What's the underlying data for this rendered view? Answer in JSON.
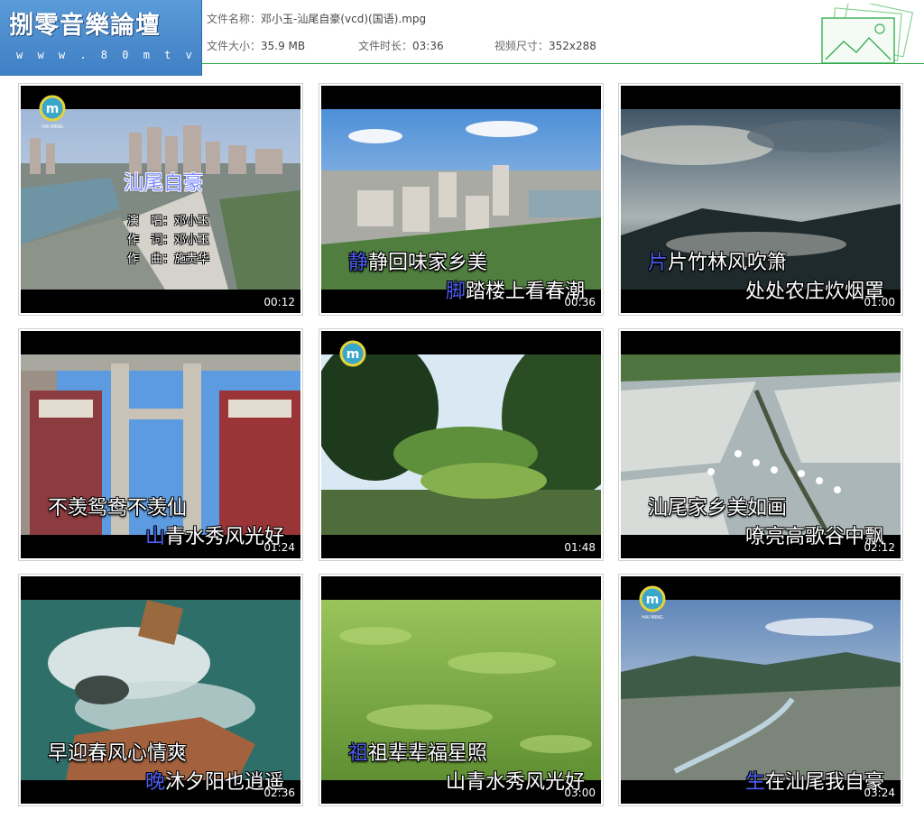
{
  "site": {
    "name": "捌零音樂論壇",
    "url": "w w w . 8 0 m t v . c o m"
  },
  "file": {
    "name_label": "文件名称：",
    "name_value": "邓小玉-汕尾自豪(vcd)(国语).mpg",
    "size_label": "文件大小：",
    "size_value": "35.9 MB",
    "duration_label": "文件时长：",
    "duration_value": "03:36",
    "dimensions_label": "视频尺寸：",
    "dimensions_value": "352x288"
  },
  "colors": {
    "logo_bg": "#4a8ccf",
    "header_rule": "#2ea84a",
    "lyric_highlight": "#4b5cf0"
  },
  "thumbnails": [
    {
      "time": "00:12",
      "title": "汕尾自豪",
      "credits": [
        "演　唱：邓小玉",
        "作　词：邓小玉",
        "作　曲：施贵华"
      ],
      "logo_text": "HAI MING"
    },
    {
      "time": "00:36",
      "line1_hl": "静",
      "line1": "静回味家乡美",
      "line2_hl": "脚",
      "line2": "踏楼上看春潮"
    },
    {
      "time": "01:00",
      "line1_hl": "片",
      "line1": "片竹林风吹箫",
      "line2_hl": "",
      "line2": "处处农庄炊烟罩"
    },
    {
      "time": "01:24",
      "line1_hl": "",
      "line1": "不羡鸳鸯不羡仙",
      "line2_hl": "山",
      "line2": "青水秀风光好"
    },
    {
      "time": "01:48",
      "logo_text": ""
    },
    {
      "time": "02:12",
      "line1_hl": "",
      "line1": "汕尾家乡美如画",
      "line2_hl": "",
      "line2": "嘹亮高歌谷中飘"
    },
    {
      "time": "02:36",
      "line1_hl": "",
      "line1": "早迎春风心情爽",
      "line2_hl": "晚",
      "line2": "沐夕阳也逍遥"
    },
    {
      "time": "03:00",
      "line1_hl": "祖",
      "line1": "祖辈辈福星照",
      "line2_hl": "",
      "line2": "山青水秀风光好"
    },
    {
      "time": "03:24",
      "line2_hl": "生",
      "line2": "在汕尾我自豪",
      "logo_text": "HAI MING"
    }
  ]
}
